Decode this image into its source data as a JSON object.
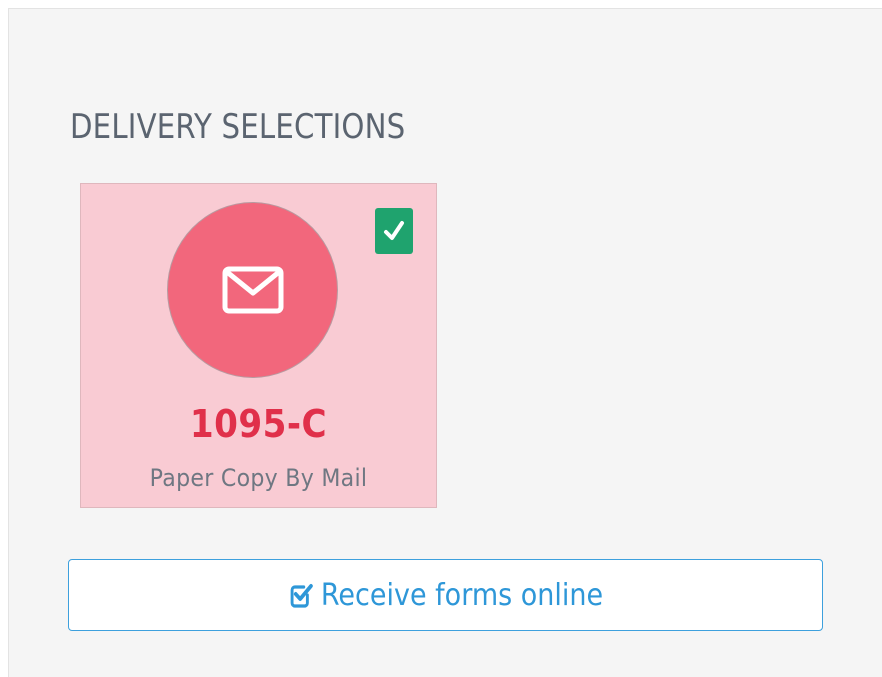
{
  "section": {
    "title": "DELIVERY SELECTIONS"
  },
  "delivery_card": {
    "form_code": "1095-C",
    "description": "Paper Copy By Mail",
    "icon": "envelope-icon",
    "selected": true,
    "selected_icon": "checkmark-icon",
    "colors": {
      "card_background": "#f9cbd3",
      "circle": "#f2677c",
      "form_code": "#e0304a",
      "check_badge": "#1fa36e"
    }
  },
  "online_button": {
    "label": "Receive forms online",
    "icon": "checked-square-icon",
    "color": "#2e97d8"
  }
}
